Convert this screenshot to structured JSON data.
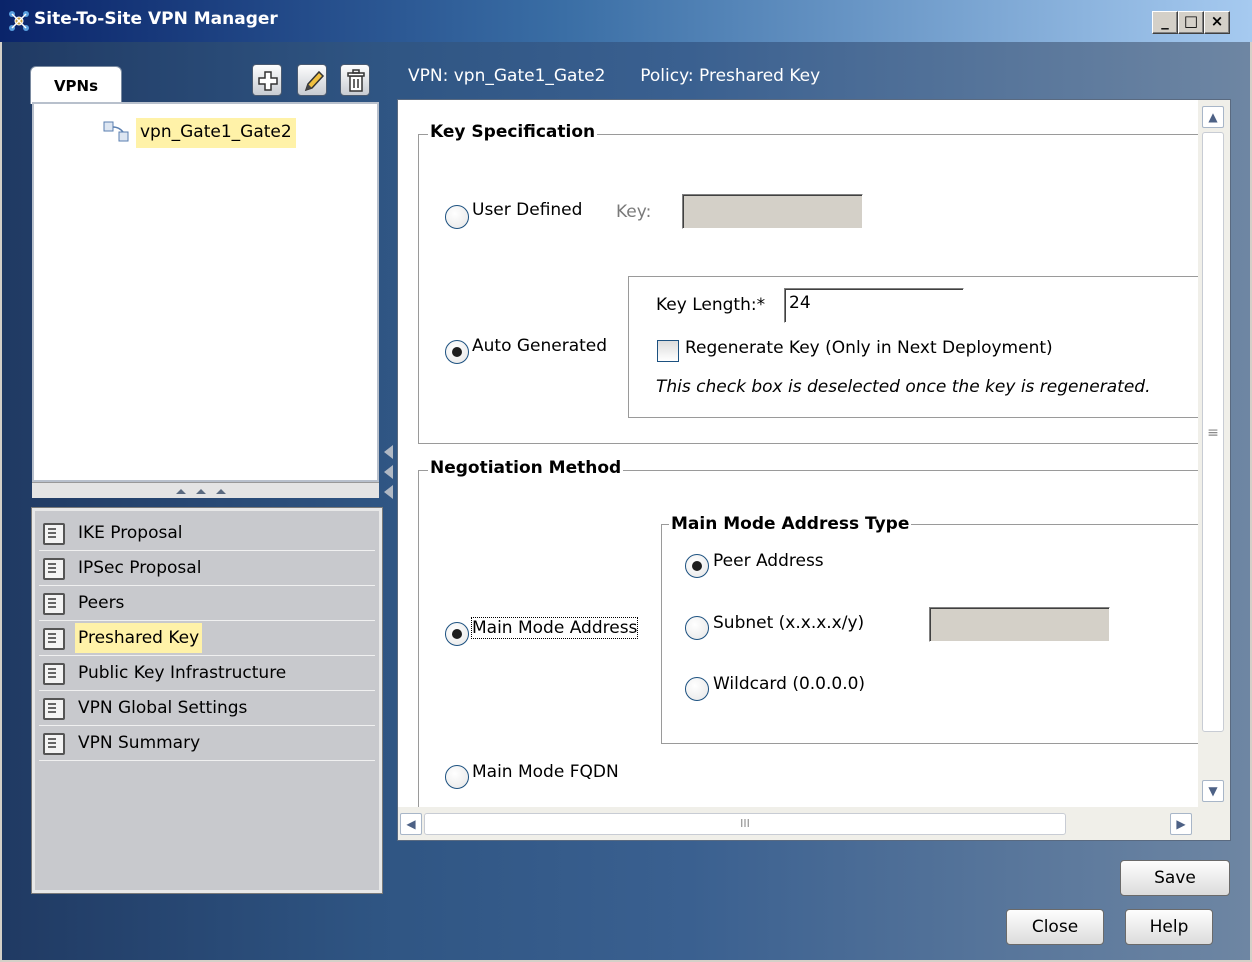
{
  "window": {
    "title": "Site-To-Site VPN Manager",
    "minimize_glyph": "_",
    "maximize_glyph": "□",
    "close_glyph": "×"
  },
  "left_panel": {
    "tab_label": "VPNs",
    "toolbar_icons": [
      "add-icon",
      "edit-pencil-icon",
      "delete-trash-icon"
    ],
    "tree_items": [
      {
        "label": "vpn_Gate1_Gate2",
        "icon": "vpn-tunnel-icon",
        "selected": true
      }
    ],
    "nav_items": [
      {
        "label": "IKE Proposal",
        "icon": "document-icon",
        "selected": false
      },
      {
        "label": "IPSec Proposal",
        "icon": "document-icon",
        "selected": false
      },
      {
        "label": "Peers",
        "icon": "document-icon",
        "selected": false
      },
      {
        "label": "Preshared Key",
        "icon": "document-icon",
        "selected": true
      },
      {
        "label": "Public Key Infrastructure",
        "icon": "document-icon",
        "selected": false
      },
      {
        "label": "VPN Global Settings",
        "icon": "document-icon",
        "selected": false
      },
      {
        "label": "VPN Summary",
        "icon": "document-icon",
        "selected": false
      }
    ]
  },
  "header": {
    "vpn_text": "VPN: vpn_Gate1_Gate2",
    "policy_text": "Policy: Preshared Key"
  },
  "key_specification": {
    "legend": "Key Specification",
    "user_defined_label": "User Defined",
    "user_defined_selected": false,
    "key_label": "Key:",
    "key_value": "",
    "auto_generated_label": "Auto Generated",
    "auto_generated_selected": true,
    "key_length_label": "Key Length:*",
    "key_length_value": "24",
    "regenerate_label": "Regenerate Key (Only in Next Deployment)",
    "regenerate_checked": false,
    "regenerate_note": "This check box is deselected once the key is regenerated."
  },
  "negotiation_method": {
    "legend": "Negotiation Method",
    "main_mode_address_label": "Main Mode Address",
    "main_mode_address_selected": true,
    "main_mode_fqdn_label": "Main Mode FQDN",
    "main_mode_fqdn_selected": false,
    "address_type": {
      "legend": "Main Mode Address Type",
      "peer_address_label": "Peer Address",
      "peer_address_selected": true,
      "subnet_label": "Subnet (x.x.x.x/y)",
      "subnet_selected": false,
      "subnet_value": "",
      "wildcard_label": "Wildcard (0.0.0.0)",
      "wildcard_selected": false
    }
  },
  "scrollbar": {
    "grip_glyph": "≡",
    "h_grip_glyph": "III",
    "up_glyph": "▲",
    "down_glyph": "▼",
    "left_glyph": "◀",
    "right_glyph": "▶"
  },
  "buttons": {
    "save": "Save",
    "close": "Close",
    "help": "Help"
  }
}
